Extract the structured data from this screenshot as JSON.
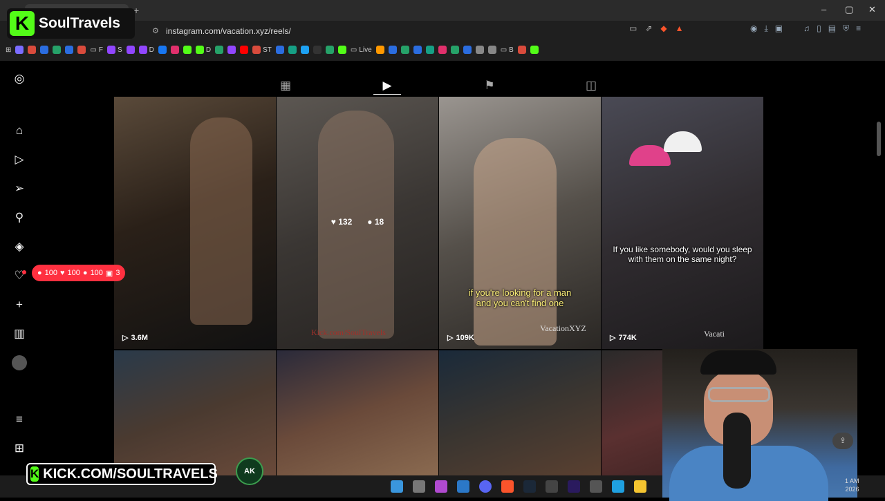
{
  "browser": {
    "tab_title": "gram",
    "new_tab": "+",
    "url": "instagram.com/vacation.xyz/reels/",
    "window_controls": [
      "–",
      "▢",
      "✕"
    ],
    "bookmarks": [
      "F",
      "S",
      "D",
      "D",
      "ST",
      "Live",
      "B"
    ]
  },
  "overlay": {
    "streamer_name": "SoulTravels",
    "kick_url": "KICK.COM/SOULTRAVELS",
    "ak_badge": "AK",
    "accent_green": "#53fc18"
  },
  "sidebar": {
    "icons": [
      "instagram-icon",
      "home-icon",
      "reels-icon",
      "direct-icon",
      "search-icon",
      "explore-icon",
      "heart-icon",
      "create-icon",
      "insights-icon",
      "avatar",
      "menu-icon",
      "apps-icon"
    ],
    "notification": {
      "comments": "100",
      "likes": "100",
      "follows": "100",
      "tags": "3"
    },
    "notif_color": "#ff3040"
  },
  "profile_tabs": [
    "posts-tab",
    "reels-tab",
    "saved-tab",
    "tagged-tab"
  ],
  "reels": [
    {
      "views": "3.6M"
    },
    {
      "likes": "132",
      "comments": "18",
      "watermark": "Kick.com/SoulTravels"
    },
    {
      "views": "109K",
      "caption": "if you're looking for a man\nand you can't find one",
      "watermark": "VacationXYZ"
    },
    {
      "views": "774K",
      "caption": "If you like somebody, would you sleep\nwith them on the same night?",
      "watermark": "Vacati"
    },
    {},
    {},
    {},
    {}
  ],
  "taskbar": {
    "clock_time": "1 AM",
    "clock_date": "2026"
  },
  "float_button": "⇪"
}
